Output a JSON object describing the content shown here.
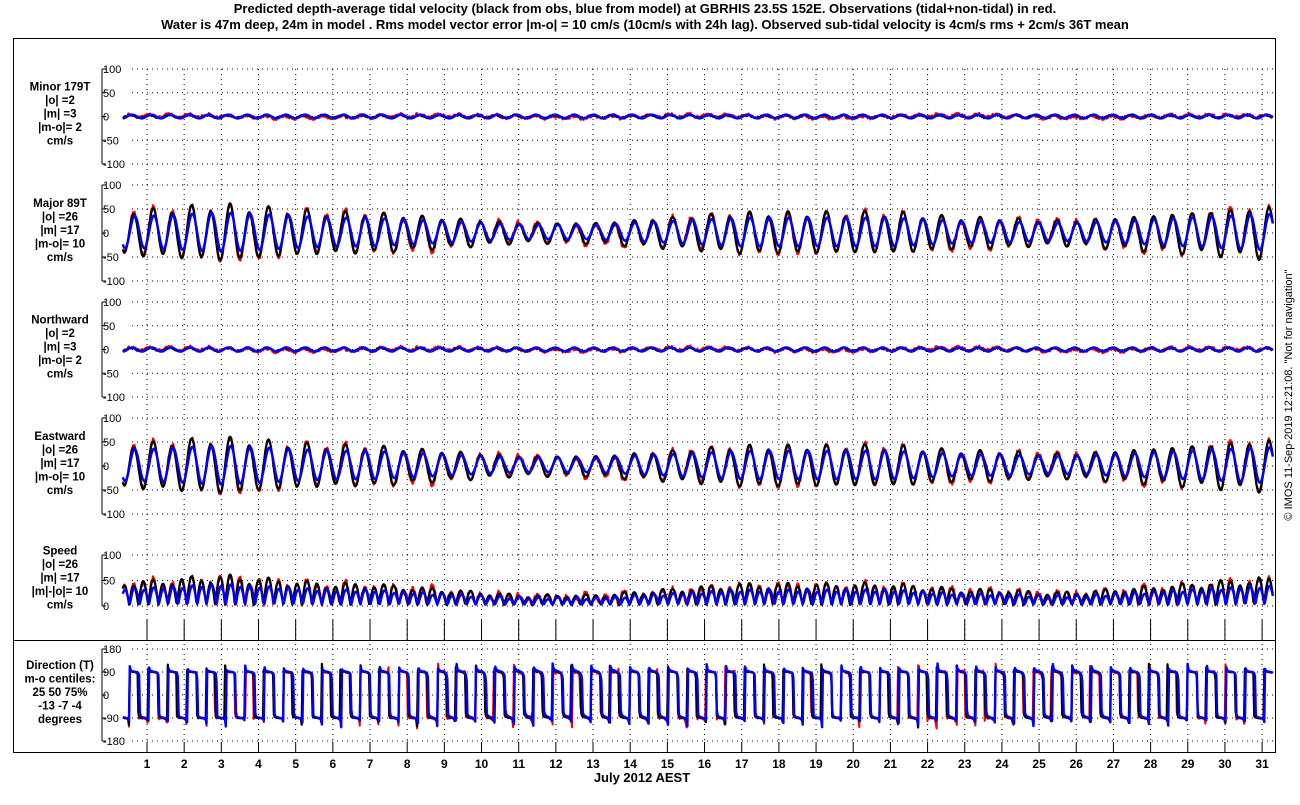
{
  "chart_data": {
    "type": "line",
    "title": [
      "Predicted depth-average tidal velocity (black from obs, blue from model) at GBRHIS 23.5S 152E. Observations (tidal+non-tidal) in red.",
      "Water is 47m deep, 24m in model . Rms model vector error |m-o| = 10 cm/s (10cm/s with 24h lag). Observed sub-tidal velocity is 4cm/s rms + 2cm/s 36T mean"
    ],
    "xlabel": "July 2012 AEST",
    "x_ticks": [
      "1",
      "2",
      "3",
      "4",
      "5",
      "6",
      "7",
      "8",
      "9",
      "10",
      "11",
      "12",
      "13",
      "14",
      "15",
      "16",
      "17",
      "18",
      "19",
      "20",
      "21",
      "22",
      "23",
      "24",
      "25",
      "26",
      "27",
      "28",
      "29",
      "30",
      "31"
    ],
    "xlim_days": [
      0.35,
      31.3
    ],
    "grid": true,
    "series_legend": [
      {
        "name": "Predicted from obs",
        "color": "#000000"
      },
      {
        "name": "Model",
        "color": "#0000ff"
      },
      {
        "name": "Observations (tidal+non-tidal)",
        "color": "#ff0000"
      }
    ],
    "tidal_period_hours": 12.42,
    "obs_major_daily_amplitude_cms": [
      45,
      50,
      55,
      50,
      45,
      40,
      40,
      35,
      30,
      25,
      20,
      20,
      20,
      25,
      30,
      35,
      40,
      40,
      40,
      40,
      40,
      35,
      30,
      30,
      25,
      25,
      30,
      35,
      40,
      45,
      50
    ],
    "model_to_obs_amplitude_ratio": 0.75,
    "panels": [
      {
        "key": "minor",
        "label": [
          "Minor 179T",
          "|o| =2",
          "|m| =3",
          "|m-o|= 2",
          "cm/s"
        ],
        "ylim": [
          -100,
          100
        ],
        "yticks": [
          "100",
          "50",
          "0",
          "-50",
          "-100"
        ]
      },
      {
        "key": "major",
        "label": [
          "Major 89T",
          "|o| =26",
          "|m| =17",
          "|m-o|= 10",
          "cm/s"
        ],
        "ylim": [
          -100,
          100
        ],
        "yticks": [
          "100",
          "50",
          "0",
          "-50",
          "-100"
        ]
      },
      {
        "key": "north",
        "label": [
          "Northward",
          "|o| =2",
          "|m| =3",
          "|m-o|= 2",
          "cm/s"
        ],
        "ylim": [
          -100,
          100
        ],
        "yticks": [
          "100",
          "50",
          "0",
          "-50",
          "-100"
        ]
      },
      {
        "key": "east",
        "label": [
          "Eastward",
          "|o| =26",
          "|m| =17",
          "|m-o|= 10",
          "cm/s"
        ],
        "ylim": [
          -100,
          100
        ],
        "yticks": [
          "100",
          "50",
          "0",
          "-50",
          "-100"
        ]
      },
      {
        "key": "speed",
        "label": [
          "Speed",
          "|o| =26",
          "|m| =17",
          "|m|-|o|= 10",
          "cm/s"
        ],
        "ylim": [
          0,
          100
        ],
        "yticks": [
          "100",
          "50",
          "0"
        ]
      },
      {
        "key": "dir",
        "label": [
          "Direction (T)",
          "m-o centiles:",
          "25  50  75%",
          "-13  -7  -4",
          "degrees"
        ],
        "ylim": [
          -180,
          180
        ],
        "yticks": [
          "180",
          "90",
          "0",
          "-90",
          "-180"
        ]
      }
    ]
  },
  "side_note": "© IMOS 11-Sep-2019 12:21:08. \"Not for navigation\""
}
